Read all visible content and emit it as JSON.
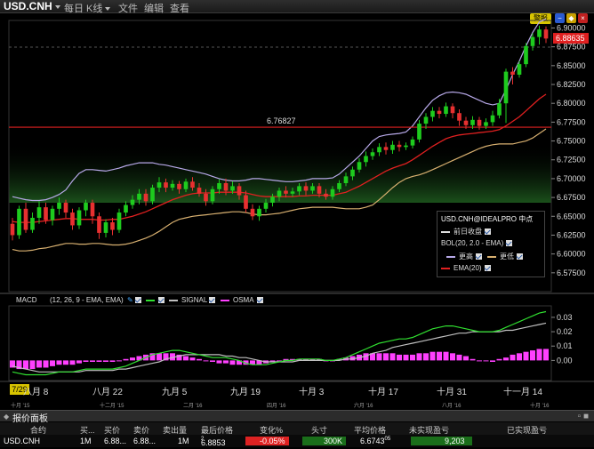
{
  "toolbar": {
    "symbol": "USD.CNH",
    "period": "每日 K线",
    "menu_file": "文件",
    "menu_edit": "编辑",
    "menu_view": "查看",
    "alert_button": "警报"
  },
  "colors": {
    "up": "#1ecb1e",
    "down": "#e83030",
    "bollinger": "#b7a8e8",
    "bollinger_lower": "#d8b070",
    "ema": "#e02020",
    "macd": "#30e030",
    "signal": "#c0c0c0",
    "osma": "#ff40ff",
    "horizontal_line": "#e02020"
  },
  "chart_data": [
    {
      "type": "candlestick",
      "symbol": "USD.CNH",
      "ylim": [
        6.55,
        6.91
      ],
      "y_ticks": [
        "6.90000",
        "6.87500",
        "6.85000",
        "6.82500",
        "6.80000",
        "6.77500",
        "6.75000",
        "6.72500",
        "6.70000",
        "6.67500",
        "6.65000",
        "6.62500",
        "6.60000",
        "6.57500"
      ],
      "last_price_label": "6.88635",
      "horizontal_line": {
        "value": 6.76827,
        "label": "6.76827"
      },
      "legend": {
        "title": "USD.CNH@IDEALPRO 中点",
        "close_label": "前日收盘",
        "bol_label": "BOL(20, 2.0 - EMA)",
        "upper_label": "更高",
        "lower_label": "更低",
        "ema_label": "EMA(20)"
      },
      "candles": [
        [
          6.64,
          6.625,
          6.648,
          6.618
        ],
        [
          6.625,
          6.66,
          6.664,
          6.62
        ],
        [
          6.66,
          6.632,
          6.668,
          6.628
        ],
        [
          6.632,
          6.648,
          6.655,
          6.628
        ],
        [
          6.648,
          6.662,
          6.67,
          6.64
        ],
        [
          6.662,
          6.645,
          6.668,
          6.64
        ],
        [
          6.645,
          6.66,
          6.664,
          6.638
        ],
        [
          6.66,
          6.668,
          6.675,
          6.652
        ],
        [
          6.668,
          6.655,
          6.672,
          6.648
        ],
        [
          6.655,
          6.638,
          6.66,
          6.632
        ],
        [
          6.638,
          6.658,
          6.662,
          6.633
        ],
        [
          6.658,
          6.668,
          6.672,
          6.65
        ],
        [
          6.668,
          6.65,
          6.672,
          6.64
        ],
        [
          6.65,
          6.628,
          6.655,
          6.62
        ],
        [
          6.628,
          6.642,
          6.646,
          6.622
        ],
        [
          6.642,
          6.632,
          6.648,
          6.625
        ],
        [
          6.632,
          6.655,
          6.66,
          6.628
        ],
        [
          6.655,
          6.665,
          6.67,
          6.65
        ],
        [
          6.665,
          6.672,
          6.678,
          6.66
        ],
        [
          6.672,
          6.68,
          6.686,
          6.666
        ],
        [
          6.68,
          6.67,
          6.686,
          6.664
        ],
        [
          6.67,
          6.688,
          6.692,
          6.666
        ],
        [
          6.688,
          6.695,
          6.702,
          6.682
        ],
        [
          6.695,
          6.688,
          6.7,
          6.682
        ],
        [
          6.688,
          6.693,
          6.698,
          6.684
        ],
        [
          6.693,
          6.686,
          6.697,
          6.68
        ],
        [
          6.686,
          6.696,
          6.7,
          6.682
        ],
        [
          6.696,
          6.688,
          6.702,
          6.684
        ],
        [
          6.688,
          6.68,
          6.694,
          6.676
        ],
        [
          6.68,
          6.67,
          6.686,
          6.664
        ],
        [
          6.67,
          6.686,
          6.69,
          6.666
        ],
        [
          6.686,
          6.694,
          6.699,
          6.68
        ],
        [
          6.694,
          6.684,
          6.7,
          6.678
        ],
        [
          6.684,
          6.69,
          6.696,
          6.68
        ],
        [
          6.69,
          6.678,
          6.694,
          6.672
        ],
        [
          6.678,
          6.66,
          6.684,
          6.655
        ],
        [
          6.66,
          6.65,
          6.666,
          6.645
        ],
        [
          6.65,
          6.66,
          6.664,
          6.644
        ],
        [
          6.66,
          6.668,
          6.673,
          6.655
        ],
        [
          6.668,
          6.676,
          6.68,
          6.663
        ],
        [
          6.676,
          6.684,
          6.688,
          6.67
        ],
        [
          6.684,
          6.68,
          6.69,
          6.675
        ],
        [
          6.68,
          6.683,
          6.688,
          6.676
        ],
        [
          6.683,
          6.69,
          6.694,
          6.678
        ],
        [
          6.69,
          6.684,
          6.695,
          6.678
        ],
        [
          6.684,
          6.69,
          6.694,
          6.68
        ],
        [
          6.69,
          6.68,
          6.694,
          6.675
        ],
        [
          6.68,
          6.676,
          6.686,
          6.672
        ],
        [
          6.676,
          6.686,
          6.69,
          6.672
        ],
        [
          6.686,
          6.694,
          6.698,
          6.682
        ],
        [
          6.694,
          6.703,
          6.708,
          6.69
        ],
        [
          6.703,
          6.712,
          6.716,
          6.698
        ],
        [
          6.712,
          6.722,
          6.727,
          6.708
        ],
        [
          6.722,
          6.73,
          6.736,
          6.716
        ],
        [
          6.73,
          6.735,
          6.74,
          6.725
        ],
        [
          6.735,
          6.742,
          6.747,
          6.73
        ],
        [
          6.742,
          6.738,
          6.748,
          6.732
        ],
        [
          6.738,
          6.745,
          6.75,
          6.733
        ],
        [
          6.745,
          6.742,
          6.75,
          6.736
        ],
        [
          6.742,
          6.744,
          6.748,
          6.738
        ],
        [
          6.744,
          6.752,
          6.756,
          6.74
        ],
        [
          6.752,
          6.773,
          6.778,
          6.748
        ],
        [
          6.773,
          6.782,
          6.787,
          6.766
        ],
        [
          6.782,
          6.79,
          6.795,
          6.776
        ],
        [
          6.79,
          6.786,
          6.795,
          6.78
        ],
        [
          6.786,
          6.796,
          6.801,
          6.782
        ],
        [
          6.796,
          6.787,
          6.8,
          6.78
        ],
        [
          6.787,
          6.777,
          6.792,
          6.77
        ],
        [
          6.777,
          6.771,
          6.782,
          6.766
        ],
        [
          6.771,
          6.778,
          6.783,
          6.766
        ],
        [
          6.778,
          6.77,
          6.782,
          6.765
        ],
        [
          6.77,
          6.775,
          6.78,
          6.766
        ],
        [
          6.775,
          6.784,
          6.79,
          6.77
        ],
        [
          6.784,
          6.8,
          6.806,
          6.78
        ],
        [
          6.8,
          6.842,
          6.846,
          6.774
        ],
        [
          6.842,
          6.838,
          6.848,
          6.825
        ],
        [
          6.838,
          6.852,
          6.856,
          6.834
        ],
        [
          6.852,
          6.876,
          6.88,
          6.848
        ],
        [
          6.876,
          6.888,
          6.893,
          6.87
        ],
        [
          6.888,
          6.898,
          6.903,
          6.878
        ],
        [
          6.898,
          6.886,
          6.902,
          6.88
        ]
      ],
      "bb_upper": [
        6.676,
        6.674,
        6.672,
        6.671,
        6.671,
        6.672,
        6.675,
        6.679,
        6.685,
        6.697,
        6.707,
        6.712,
        6.712,
        6.711,
        6.71,
        6.712,
        6.714,
        6.717,
        6.719,
        6.721,
        6.721,
        6.721,
        6.719,
        6.718,
        6.716,
        6.714,
        6.712,
        6.71,
        6.708,
        6.706,
        6.703,
        6.7,
        6.698,
        6.697,
        6.697,
        6.698,
        6.7,
        6.7,
        6.699,
        6.698,
        6.697,
        6.696,
        6.696,
        6.697,
        6.698,
        6.7,
        6.7,
        6.7,
        6.701,
        6.706,
        6.714,
        6.722,
        6.73,
        6.74,
        6.75,
        6.756,
        6.758,
        6.759,
        6.76,
        6.762,
        6.77,
        6.782,
        6.794,
        6.804,
        6.81,
        6.814,
        6.815,
        6.814,
        6.812,
        6.808,
        6.804,
        6.8,
        6.798,
        6.8,
        6.818,
        6.838,
        6.856,
        6.876,
        6.894,
        6.908,
        6.912
      ],
      "bb_lower": [
        6.606,
        6.604,
        6.604,
        6.605,
        6.607,
        6.608,
        6.61,
        6.612,
        6.614,
        6.614,
        6.613,
        6.613,
        6.614,
        6.614,
        6.613,
        6.612,
        6.612,
        6.613,
        6.615,
        6.618,
        6.621,
        6.625,
        6.63,
        6.636,
        6.642,
        6.646,
        6.648,
        6.65,
        6.651,
        6.652,
        6.653,
        6.654,
        6.655,
        6.656,
        6.656,
        6.655,
        6.653,
        6.652,
        6.652,
        6.653,
        6.654,
        6.656,
        6.658,
        6.66,
        6.661,
        6.662,
        6.662,
        6.662,
        6.662,
        6.661,
        6.66,
        6.66,
        6.66,
        6.662,
        6.665,
        6.672,
        6.68,
        6.688,
        6.695,
        6.7,
        6.703,
        6.705,
        6.708,
        6.712,
        6.716,
        6.72,
        6.724,
        6.728,
        6.732,
        6.736,
        6.74,
        6.743,
        6.745,
        6.746,
        6.746,
        6.746,
        6.748,
        6.75,
        6.754,
        6.76,
        6.766
      ],
      "ema20": [
        6.643,
        6.642,
        6.642,
        6.642,
        6.643,
        6.644,
        6.645,
        6.646,
        6.647,
        6.647,
        6.646,
        6.646,
        6.646,
        6.645,
        6.645,
        6.646,
        6.646,
        6.648,
        6.65,
        6.653,
        6.656,
        6.66,
        6.664,
        6.668,
        6.672,
        6.675,
        6.678,
        6.68,
        6.681,
        6.681,
        6.681,
        6.682,
        6.682,
        6.682,
        6.682,
        6.681,
        6.679,
        6.677,
        6.676,
        6.676,
        6.676,
        6.676,
        6.676,
        6.677,
        6.677,
        6.678,
        6.678,
        6.678,
        6.678,
        6.68,
        6.682,
        6.686,
        6.69,
        6.695,
        6.7,
        6.705,
        6.71,
        6.714,
        6.717,
        6.72,
        6.725,
        6.731,
        6.737,
        6.743,
        6.748,
        6.753,
        6.756,
        6.758,
        6.759,
        6.76,
        6.761,
        6.762,
        6.763,
        6.765,
        6.77,
        6.776,
        6.782,
        6.79,
        6.798,
        6.806,
        6.812
      ]
    },
    {
      "type": "macd",
      "header": {
        "label": "MACD",
        "params": "(12, 26, 9 - EMA, EMA)",
        "signal": "SIGNAL",
        "osma": "OSMA"
      },
      "ylim": [
        -0.014,
        0.038
      ],
      "y_ticks": [
        "0.03",
        "0.02",
        "0.01",
        "0.00"
      ],
      "macd": [
        -0.008,
        -0.009,
        -0.01,
        -0.01,
        -0.01,
        -0.01,
        -0.009,
        -0.008,
        -0.008,
        -0.008,
        -0.007,
        -0.006,
        -0.006,
        -0.006,
        -0.006,
        -0.006,
        -0.005,
        -0.004,
        -0.002,
        0.0,
        0.002,
        0.004,
        0.005,
        0.006,
        0.007,
        0.007,
        0.006,
        0.005,
        0.004,
        0.003,
        0.002,
        0.002,
        0.002,
        0.001,
        0.0,
        -0.002,
        -0.003,
        -0.003,
        -0.003,
        -0.002,
        -0.001,
        0.0,
        0.0,
        0.001,
        0.001,
        0.001,
        0.001,
        0.0,
        0.0,
        0.001,
        0.002,
        0.004,
        0.006,
        0.008,
        0.01,
        0.012,
        0.013,
        0.014,
        0.015,
        0.015,
        0.016,
        0.018,
        0.02,
        0.022,
        0.023,
        0.024,
        0.024,
        0.023,
        0.022,
        0.021,
        0.02,
        0.02,
        0.02,
        0.021,
        0.023,
        0.025,
        0.027,
        0.029,
        0.031,
        0.033,
        0.034
      ],
      "signal": [
        -0.004,
        -0.005,
        -0.006,
        -0.007,
        -0.008,
        -0.008,
        -0.008,
        -0.008,
        -0.008,
        -0.008,
        -0.008,
        -0.007,
        -0.007,
        -0.007,
        -0.007,
        -0.007,
        -0.006,
        -0.006,
        -0.005,
        -0.004,
        -0.003,
        -0.002,
        -0.001,
        0.001,
        0.002,
        0.003,
        0.004,
        0.004,
        0.004,
        0.004,
        0.004,
        0.004,
        0.003,
        0.003,
        0.002,
        0.002,
        0.001,
        0.0,
        -0.001,
        -0.001,
        -0.001,
        -0.001,
        -0.001,
        0.0,
        0.0,
        0.0,
        0.0,
        0.0,
        0.0,
        0.0,
        0.001,
        0.001,
        0.002,
        0.003,
        0.005,
        0.006,
        0.007,
        0.009,
        0.01,
        0.011,
        0.012,
        0.013,
        0.014,
        0.015,
        0.016,
        0.017,
        0.018,
        0.019,
        0.019,
        0.02,
        0.02,
        0.02,
        0.02,
        0.02,
        0.021,
        0.021,
        0.022,
        0.023,
        0.024,
        0.025,
        0.026
      ],
      "osma": [
        -0.005,
        -0.006,
        -0.006,
        -0.006,
        -0.005,
        -0.005,
        -0.004,
        -0.003,
        -0.003,
        -0.003,
        -0.002,
        -0.001,
        -0.001,
        -0.001,
        -0.001,
        -0.001,
        0.0,
        0.001,
        0.002,
        0.003,
        0.004,
        0.005,
        0.005,
        0.005,
        0.005,
        0.004,
        0.003,
        0.002,
        0.001,
        0.0,
        -0.001,
        -0.002,
        -0.002,
        -0.003,
        -0.003,
        -0.003,
        -0.003,
        -0.003,
        -0.002,
        -0.001,
        0.0,
        0.001,
        0.001,
        0.001,
        0.001,
        0.001,
        0.001,
        0.0,
        0.0,
        0.001,
        0.002,
        0.003,
        0.004,
        0.005,
        0.005,
        0.005,
        0.005,
        0.005,
        0.004,
        0.004,
        0.004,
        0.005,
        0.005,
        0.006,
        0.006,
        0.006,
        0.005,
        0.004,
        0.003,
        0.001,
        0.0,
        0.0,
        -0.001,
        0.001,
        0.002,
        0.004,
        0.005,
        0.006,
        0.007,
        0.008,
        0.008
      ]
    }
  ],
  "time_axis": {
    "labels": [
      "八月 8",
      "八月 22",
      "九月 5",
      "九月 19",
      "十月 3",
      "十月 17",
      "十月 31",
      "十一月 14"
    ],
    "labels_small": [
      "十月 '15",
      "十二月 '15",
      "二月 '16",
      "四月 '16",
      "六月 '16",
      "八月 '16",
      "十月 '16"
    ],
    "date_badge": "7/29"
  },
  "panel": {
    "title": "报价面板",
    "columns": [
      "合约",
      "买...",
      "买价",
      "卖价",
      "卖出量",
      "最后价格",
      "变化%",
      "头寸",
      "平均价格",
      "未实现盈亏",
      "已实现盈亏"
    ],
    "row": {
      "contract": "USD.CNH",
      "bid_size": "1M",
      "bid": "6.88...",
      "ask": "6.88...",
      "ask_size": "1M",
      "last": "6.8853",
      "last_sup": "2",
      "change": "-0.05%",
      "position": "300K",
      "avg_price": "6.6743",
      "avg_sup": "05",
      "unrealized": "9,203",
      "realized": ""
    }
  }
}
